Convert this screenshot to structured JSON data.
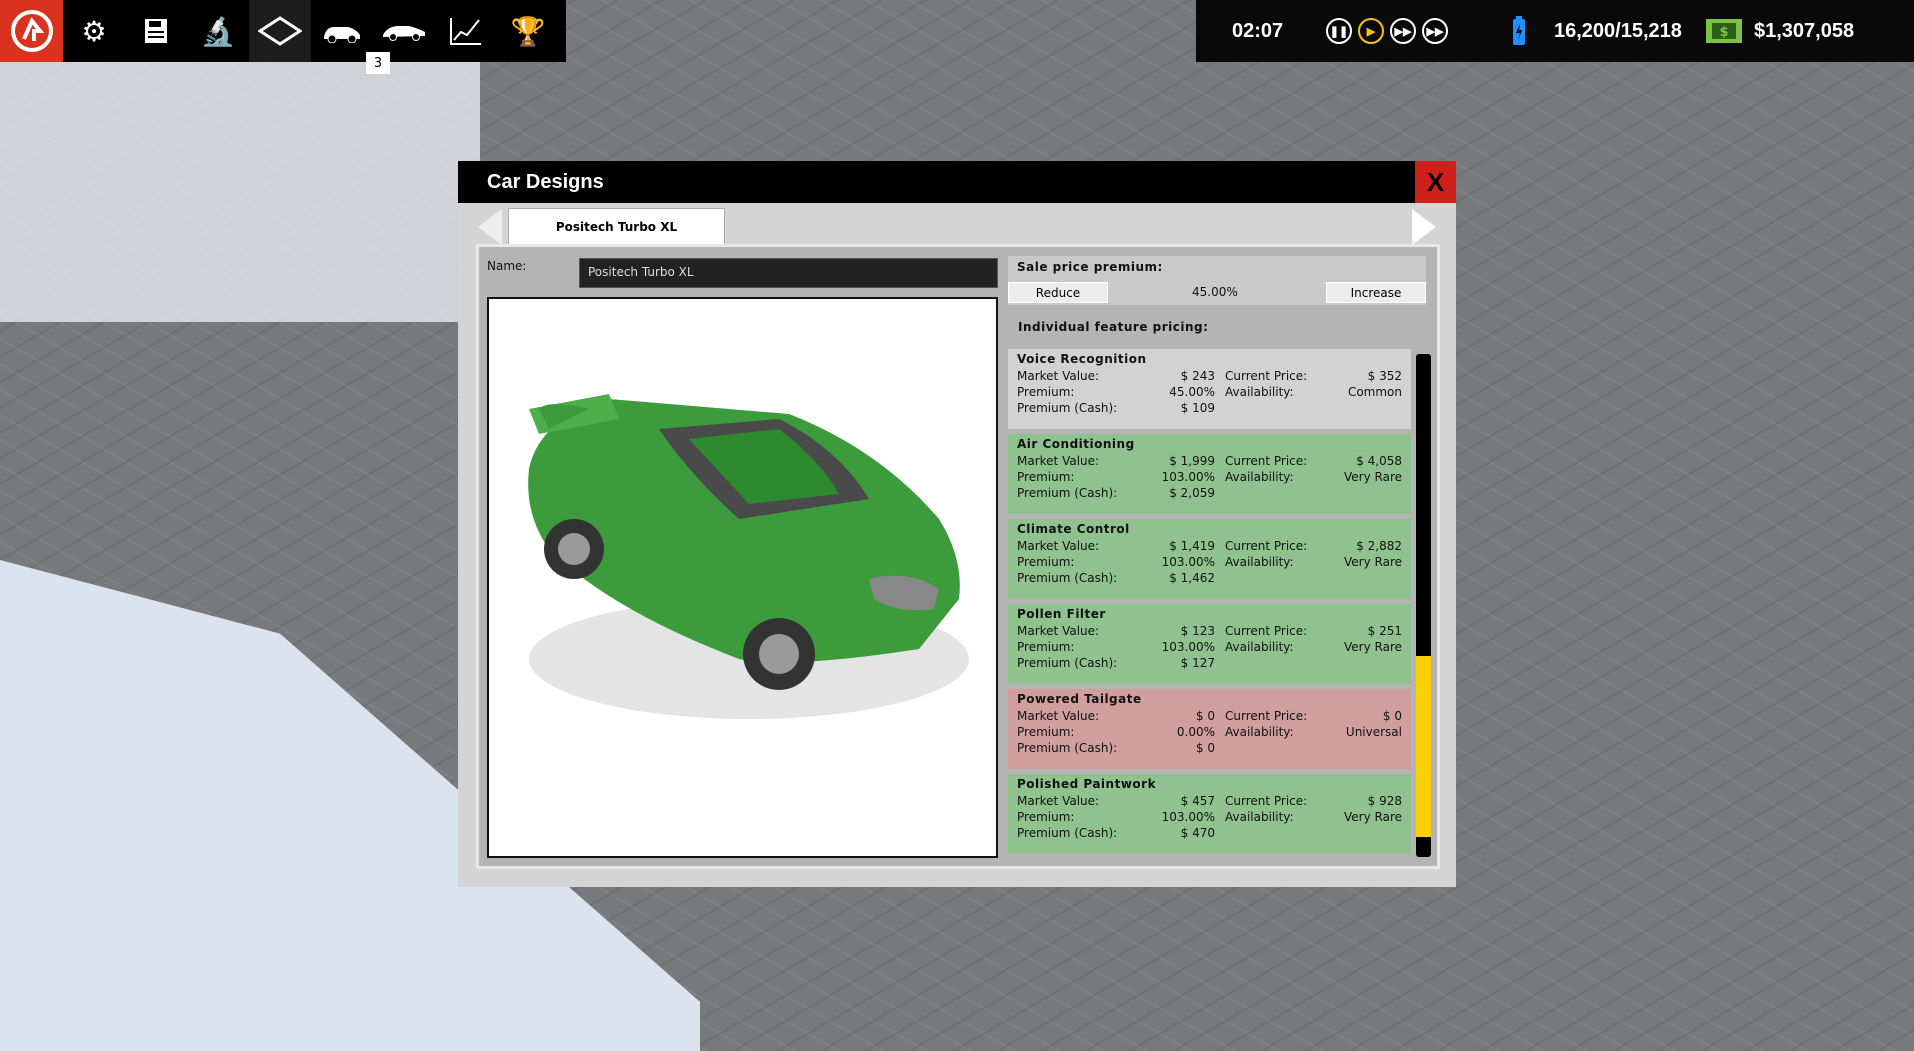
{
  "toolbar": {
    "icons": [
      "logo-icon",
      "gear-icon",
      "save-icon",
      "microscope-icon",
      "diamond-view-icon",
      "car-designs-icon",
      "car-icon",
      "chart-icon",
      "trophy-icon"
    ],
    "badge": "3"
  },
  "status": {
    "time": "02:07",
    "power": "16,200/15,218",
    "cash": "$1,307,058",
    "accent": "#f7c400"
  },
  "dialog": {
    "title": "Car Designs",
    "close": "X",
    "tab": "Positech Turbo XL",
    "name_label": "Name:",
    "name_value": "Positech Turbo XL",
    "sale_premium_label": "Sale price premium:",
    "reduce": "Reduce",
    "increase": "Increase",
    "premium_value": "45.00%",
    "feature_header": "Individual feature pricing:",
    "labels": {
      "market": "Market Value:",
      "premium": "Premium:",
      "cash": "Premium (Cash):",
      "current": "Current Price:",
      "availability": "Availability:"
    },
    "scroll_position": {
      "thumb_start": 0.6,
      "thumb_end": 0.96
    },
    "colors": {
      "positive": "#8fc28f",
      "negative": "#d19e9e",
      "neutral": "#d2d2d2"
    },
    "features": [
      {
        "name": "Voice Recognition",
        "market": "$ 243",
        "premium": "45.00%",
        "cash": "$ 109",
        "current": "$ 352",
        "availability": "Common",
        "state": "neutral"
      },
      {
        "name": "Air Conditioning",
        "market": "$ 1,999",
        "premium": "103.00%",
        "cash": "$ 2,059",
        "current": "$ 4,058",
        "availability": "Very Rare",
        "state": "positive"
      },
      {
        "name": "Climate Control",
        "market": "$ 1,419",
        "premium": "103.00%",
        "cash": "$ 1,462",
        "current": "$ 2,882",
        "availability": "Very Rare",
        "state": "positive"
      },
      {
        "name": "Pollen Filter",
        "market": "$ 123",
        "premium": "103.00%",
        "cash": "$ 127",
        "current": "$ 251",
        "availability": "Very Rare",
        "state": "positive"
      },
      {
        "name": "Powered Tailgate",
        "market": "$ 0",
        "premium": "0.00%",
        "cash": "$ 0",
        "current": "$ 0",
        "availability": "Universal",
        "state": "negative"
      },
      {
        "name": "Polished Paintwork",
        "market": "$ 457",
        "premium": "103.00%",
        "cash": "$ 470",
        "current": "$ 928",
        "availability": "Very Rare",
        "state": "positive"
      }
    ]
  }
}
